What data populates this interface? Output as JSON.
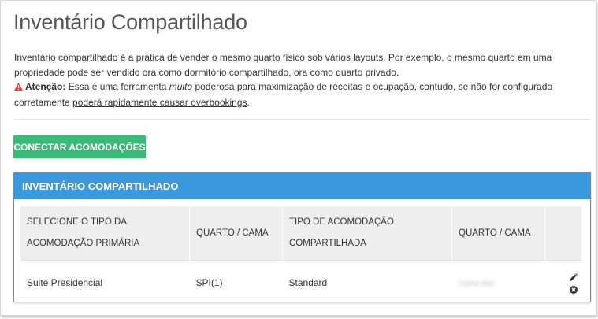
{
  "page": {
    "title": "Inventário Compartilhado"
  },
  "description": {
    "line1": "Inventário compartilhado é a prática de vender o mesmo quarto físico sob vários layouts. Por exemplo, o mesmo quarto em uma propriedade pode ser vendido ora como dormitório compartilhado, ora como quarto privado.",
    "warning_label": "Atenção:",
    "warning_text_1": "Essa é uma ferramenta",
    "warning_emphasis": "muito",
    "warning_text_2": "poderosa para maximização de receitas e ocupação, contudo, se não for configurado corretamente",
    "warning_link": "poderá rapidamente causar overbookings",
    "warning_end": "."
  },
  "actions": {
    "connect_label": "Conectar Acomodações"
  },
  "panel": {
    "title": "Inventário Compartilhado",
    "columns": [
      "Selecione o tipo da acomodação primária",
      "Quarto / Cama",
      "Tipo de acomodação compartilhada",
      "Quarto / Cama"
    ],
    "rows": [
      {
        "primary_type": "Suite Presidencial",
        "primary_room": "SPI(1)",
        "shared_type": "Standard",
        "shared_room": "Cama dorr"
      }
    ]
  },
  "icons": {
    "warning": "warning-triangle-icon",
    "edit": "pencil-icon",
    "delete": "close-circle-icon"
  },
  "colors": {
    "accent_blue": "#3a99dd",
    "button_green": "#3cb878",
    "warning_red": "#d9413a"
  }
}
